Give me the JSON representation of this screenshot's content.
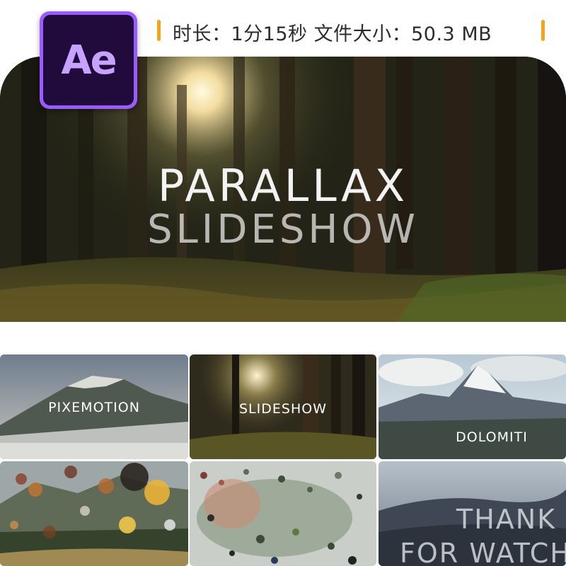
{
  "header": {
    "info_text": "时长：1分15秒  文件大小：50.3 MB",
    "accent_color": "#f4a31c"
  },
  "logo": {
    "text": "Ae",
    "icon": "after-effects-logo-icon"
  },
  "hero": {
    "title": "PARALLAX",
    "subtitle": "SLIDESHOW"
  },
  "thumbnails": [
    {
      "label": "PIXEMOTION"
    },
    {
      "label": "SLIDESHOW"
    },
    {
      "label": "DOLOMITI"
    },
    {
      "label": ""
    },
    {
      "label": ""
    },
    {
      "label": "THANK FOR WATCH"
    }
  ],
  "thank_you": {
    "line1": "THANK",
    "line2": "FOR WATCH"
  }
}
